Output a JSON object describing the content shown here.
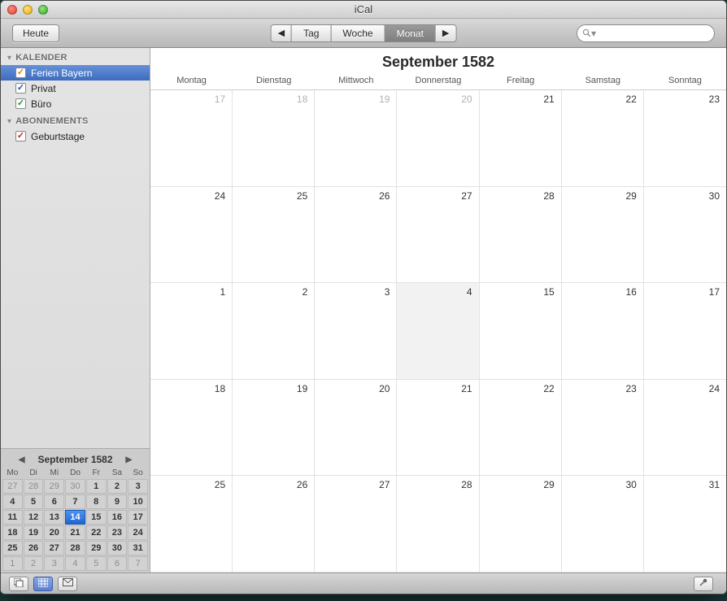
{
  "window": {
    "title": "iCal"
  },
  "toolbar": {
    "today": "Heute",
    "prev": "◀",
    "next": "▶",
    "views": {
      "day": "Tag",
      "week": "Woche",
      "month": "Monat"
    },
    "search_placeholder": ""
  },
  "sidebar": {
    "groups": [
      {
        "title": "KALENDER",
        "items": [
          {
            "label": "Ferien Bayern",
            "color": "orange",
            "checked": true,
            "selected": true
          },
          {
            "label": "Privat",
            "color": "blue",
            "checked": true,
            "selected": false
          },
          {
            "label": "Büro",
            "color": "green",
            "checked": true,
            "selected": false
          }
        ]
      },
      {
        "title": "ABONNEMENTS",
        "items": [
          {
            "label": "Geburtstage",
            "color": "red",
            "checked": true,
            "selected": false
          }
        ]
      }
    ]
  },
  "minical": {
    "title": "September 1582",
    "weekdays": [
      "Mo",
      "Di",
      "Mi",
      "Do",
      "Fr",
      "Sa",
      "So"
    ],
    "rows": [
      [
        {
          "n": "27",
          "dim": true
        },
        {
          "n": "28",
          "dim": true
        },
        {
          "n": "29",
          "dim": true
        },
        {
          "n": "30",
          "dim": true
        },
        {
          "n": "1"
        },
        {
          "n": "2"
        },
        {
          "n": "3"
        }
      ],
      [
        {
          "n": "4"
        },
        {
          "n": "5"
        },
        {
          "n": "6"
        },
        {
          "n": "7"
        },
        {
          "n": "8"
        },
        {
          "n": "9"
        },
        {
          "n": "10"
        }
      ],
      [
        {
          "n": "11"
        },
        {
          "n": "12"
        },
        {
          "n": "13"
        },
        {
          "n": "14",
          "sel": true
        },
        {
          "n": "15"
        },
        {
          "n": "16"
        },
        {
          "n": "17"
        }
      ],
      [
        {
          "n": "18"
        },
        {
          "n": "19"
        },
        {
          "n": "20"
        },
        {
          "n": "21"
        },
        {
          "n": "22"
        },
        {
          "n": "23"
        },
        {
          "n": "24"
        }
      ],
      [
        {
          "n": "25"
        },
        {
          "n": "26"
        },
        {
          "n": "27"
        },
        {
          "n": "28"
        },
        {
          "n": "29"
        },
        {
          "n": "30"
        },
        {
          "n": "31"
        }
      ],
      [
        {
          "n": "1",
          "dim": true
        },
        {
          "n": "2",
          "dim": true
        },
        {
          "n": "3",
          "dim": true
        },
        {
          "n": "4",
          "dim": true
        },
        {
          "n": "5",
          "dim": true
        },
        {
          "n": "6",
          "dim": true
        },
        {
          "n": "7",
          "dim": true
        }
      ]
    ]
  },
  "main": {
    "month_title": "September 1582",
    "weekdays": [
      "Montag",
      "Dienstag",
      "Mittwoch",
      "Donnerstag",
      "Freitag",
      "Samstag",
      "Sonntag"
    ],
    "weeks": [
      [
        {
          "n": "17",
          "dim": true
        },
        {
          "n": "18",
          "dim": true
        },
        {
          "n": "19",
          "dim": true
        },
        {
          "n": "20",
          "dim": true
        },
        {
          "n": "21"
        },
        {
          "n": "22"
        },
        {
          "n": "23"
        }
      ],
      [
        {
          "n": "24"
        },
        {
          "n": "25"
        },
        {
          "n": "26"
        },
        {
          "n": "27"
        },
        {
          "n": "28"
        },
        {
          "n": "29"
        },
        {
          "n": "30"
        }
      ],
      [
        {
          "n": "1"
        },
        {
          "n": "2"
        },
        {
          "n": "3"
        },
        {
          "n": "4",
          "today": true
        },
        {
          "n": "15"
        },
        {
          "n": "16"
        },
        {
          "n": "17"
        }
      ],
      [
        {
          "n": "18"
        },
        {
          "n": "19"
        },
        {
          "n": "20"
        },
        {
          "n": "21"
        },
        {
          "n": "22"
        },
        {
          "n": "23"
        },
        {
          "n": "24"
        }
      ],
      [
        {
          "n": "25"
        },
        {
          "n": "26"
        },
        {
          "n": "27"
        },
        {
          "n": "28"
        },
        {
          "n": "29"
        },
        {
          "n": "30"
        },
        {
          "n": "31"
        }
      ]
    ]
  }
}
